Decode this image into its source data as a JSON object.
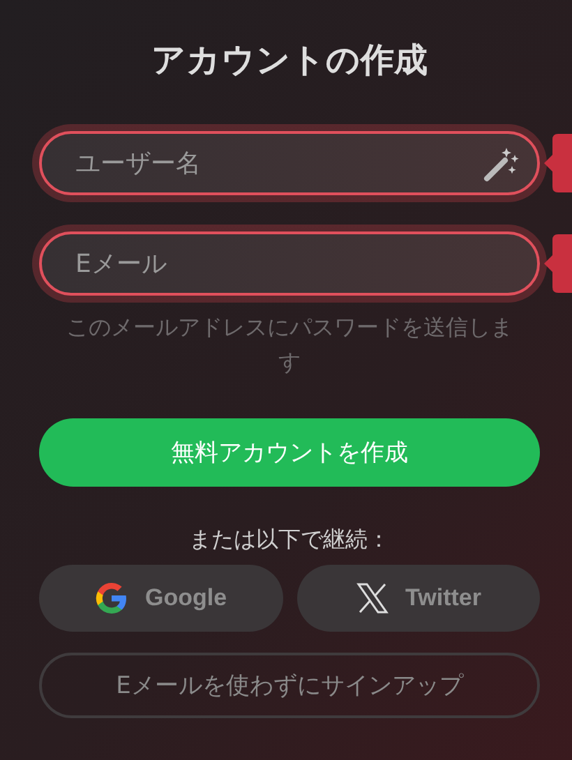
{
  "title": "アカウントの作成",
  "fields": [
    {
      "placeholder": "ユーザー名",
      "invalid": true,
      "kind": "username"
    },
    {
      "placeholder": "Eメール",
      "invalid": true,
      "kind": "email"
    }
  ],
  "email_hint": "このメールアドレスにパスワードを送信します",
  "create_button": "無料アカウントを作成",
  "continue_label": "または以下で継続：",
  "social_buttons": [
    {
      "label": "Google",
      "kind": "google"
    },
    {
      "label": "Twitter",
      "kind": "x"
    }
  ],
  "no_email_button": "Eメールを使わずにサインアップ"
}
